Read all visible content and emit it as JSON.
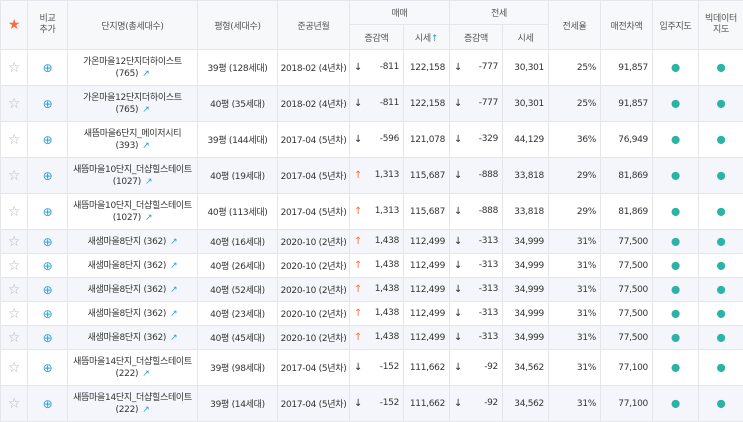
{
  "header": {
    "compare": "비교\n추가",
    "complex": "단지명(총세대수)",
    "area": "평형(세대수)",
    "year": "준공년월",
    "sale": "매매",
    "rent": "전세",
    "sale_change": "증감액",
    "sale_price": "시세",
    "sale_price_sort": "↑",
    "rent_change": "증감액",
    "rent_price": "시세",
    "rent_rate": "전세율",
    "gap": "매전차액",
    "map": "입주지도",
    "bigdata": "빅데이터\n지도"
  },
  "icons": {
    "header_star": "star-filled-icon",
    "star": "star-outline-icon",
    "compare": "add-compare-icon",
    "chart": "chart-icon",
    "pin": "map-pin-icon"
  },
  "colors": {
    "accent": "#ff6a3d",
    "link": "#2a9fd6",
    "pin": "#2bb3a6",
    "header_bg": "#f7f8fa",
    "row_alt": "#f4f6fb"
  },
  "rows": [
    {
      "name": "가온마을12단지더하이스트 (765)",
      "area": "39평 (128세대)",
      "year": "2018-02 (4년차)",
      "sale_dir": "down",
      "sale_change": "-811",
      "sale_price": "122,158",
      "rent_dir": "down",
      "rent_change": "-777",
      "rent_price": "30,301",
      "rate": "25%",
      "gap": "91,857"
    },
    {
      "name": "가온마을12단지더하이스트 (765)",
      "area": "40평 (35세대)",
      "year": "2018-02 (4년차)",
      "sale_dir": "down",
      "sale_change": "-811",
      "sale_price": "122,158",
      "rent_dir": "down",
      "rent_change": "-777",
      "rent_price": "30,301",
      "rate": "25%",
      "gap": "91,857"
    },
    {
      "name": "새뜸마을6단지_메이저시티 (393)",
      "area": "39평 (144세대)",
      "year": "2017-04 (5년차)",
      "sale_dir": "down",
      "sale_change": "-596",
      "sale_price": "121,078",
      "rent_dir": "down",
      "rent_change": "-329",
      "rent_price": "44,129",
      "rate": "36%",
      "gap": "76,949"
    },
    {
      "name": "새뜸마을10단지_더샵힐스테이트 (1027)",
      "area": "40평 (19세대)",
      "year": "2017-04 (5년차)",
      "sale_dir": "up",
      "sale_change": "1,313",
      "sale_price": "115,687",
      "rent_dir": "down",
      "rent_change": "-888",
      "rent_price": "33,818",
      "rate": "29%",
      "gap": "81,869"
    },
    {
      "name": "새뜸마을10단지_더샵힐스테이트 (1027)",
      "area": "40평 (113세대)",
      "year": "2017-04 (5년차)",
      "sale_dir": "up",
      "sale_change": "1,313",
      "sale_price": "115,687",
      "rent_dir": "down",
      "rent_change": "-888",
      "rent_price": "33,818",
      "rate": "29%",
      "gap": "81,869"
    },
    {
      "name": "새샘마을8단지 (362)",
      "area": "40평 (16세대)",
      "year": "2020-10 (2년차)",
      "sale_dir": "up",
      "sale_change": "1,438",
      "sale_price": "112,499",
      "rent_dir": "down",
      "rent_change": "-313",
      "rent_price": "34,999",
      "rate": "31%",
      "gap": "77,500"
    },
    {
      "name": "새샘마을8단지 (362)",
      "area": "40평 (26세대)",
      "year": "2020-10 (2년차)",
      "sale_dir": "up",
      "sale_change": "1,438",
      "sale_price": "112,499",
      "rent_dir": "down",
      "rent_change": "-313",
      "rent_price": "34,999",
      "rate": "31%",
      "gap": "77,500"
    },
    {
      "name": "새샘마을8단지 (362)",
      "area": "40평 (52세대)",
      "year": "2020-10 (2년차)",
      "sale_dir": "up",
      "sale_change": "1,438",
      "sale_price": "112,499",
      "rent_dir": "down",
      "rent_change": "-313",
      "rent_price": "34,999",
      "rate": "31%",
      "gap": "77,500"
    },
    {
      "name": "새샘마을8단지 (362)",
      "area": "40평 (23세대)",
      "year": "2020-10 (2년차)",
      "sale_dir": "up",
      "sale_change": "1,438",
      "sale_price": "112,499",
      "rent_dir": "down",
      "rent_change": "-313",
      "rent_price": "34,999",
      "rate": "31%",
      "gap": "77,500"
    },
    {
      "name": "새샘마을8단지 (362)",
      "area": "40평 (45세대)",
      "year": "2020-10 (2년차)",
      "sale_dir": "up",
      "sale_change": "1,438",
      "sale_price": "112,499",
      "rent_dir": "down",
      "rent_change": "-313",
      "rent_price": "34,999",
      "rate": "31%",
      "gap": "77,500"
    },
    {
      "name": "새뜸마을14단지_더샵힐스테이트 (222)",
      "area": "39평 (98세대)",
      "year": "2017-04 (5년차)",
      "sale_dir": "down",
      "sale_change": "-152",
      "sale_price": "111,662",
      "rent_dir": "down",
      "rent_change": "-92",
      "rent_price": "34,562",
      "rate": "31%",
      "gap": "77,100"
    },
    {
      "name": "새뜸마을14단지_더샵힐스테이트 (222)",
      "area": "39평 (14세대)",
      "year": "2017-04 (5년차)",
      "sale_dir": "down",
      "sale_change": "-152",
      "sale_price": "111,662",
      "rent_dir": "down",
      "rent_change": "-92",
      "rent_price": "34,562",
      "rate": "31%",
      "gap": "77,100"
    }
  ]
}
